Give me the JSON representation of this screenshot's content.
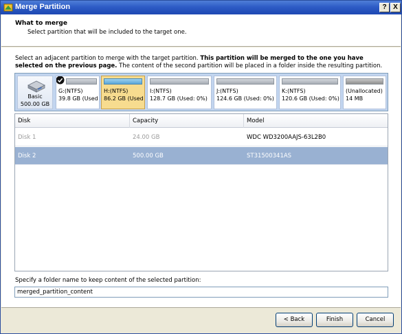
{
  "window": {
    "title": "Merge Partition",
    "help_label": "?",
    "close_label": "X"
  },
  "header": {
    "title": "What to merge",
    "subtitle": "Select partition that will be included to the target one."
  },
  "description": {
    "normal_1": "Select an adjacent partition to merge with the target partition. ",
    "bold": "This partition will be merged to the one you have selected on the previous page.",
    "normal_2": " The content of the second partition will be placed in a folder inside the resulting partition."
  },
  "disk_map": {
    "disk": {
      "name": "Basic",
      "size": "500.00 GB"
    },
    "partitions": [
      {
        "name": "G:(NTFS)",
        "info": "39.8 GB (Used",
        "checked": true,
        "selected": false
      },
      {
        "name": "H:(NTFS)",
        "info": "86.2 GB (Used",
        "checked": false,
        "selected": true
      },
      {
        "name": "I:(NTFS)",
        "info": "128.7 GB (Used: 0%)",
        "checked": false,
        "selected": false
      },
      {
        "name": "J:(NTFS)",
        "info": "124.6 GB (Used: 0%)",
        "checked": false,
        "selected": false
      },
      {
        "name": "K:(NTFS)",
        "info": "120.6 GB (Used: 0%)",
        "checked": false,
        "selected": false
      },
      {
        "name": "(Unallocated)",
        "info": "14 MB",
        "checked": false,
        "selected": false
      }
    ]
  },
  "disk_table": {
    "columns": [
      "Disk",
      "Capacity",
      "Model"
    ],
    "rows": [
      {
        "disk": "Disk 1",
        "capacity": "24.00 GB",
        "model": "WDC WD3200AAJS-63L2B0"
      },
      {
        "disk": "Disk 2",
        "capacity": "500.00 GB",
        "model": "ST31500341AS"
      }
    ],
    "selected_row": 1
  },
  "folder": {
    "label": "Specify a folder name to keep content of the selected partition:",
    "value": "merged_partition_content"
  },
  "buttons": {
    "back": "< Back",
    "finish": "Finish",
    "cancel": "Cancel"
  },
  "colors": {
    "titlebar": "#2e5cc6",
    "selected_partition": "#f7dc8f",
    "selected_row": "#99b1d2"
  }
}
